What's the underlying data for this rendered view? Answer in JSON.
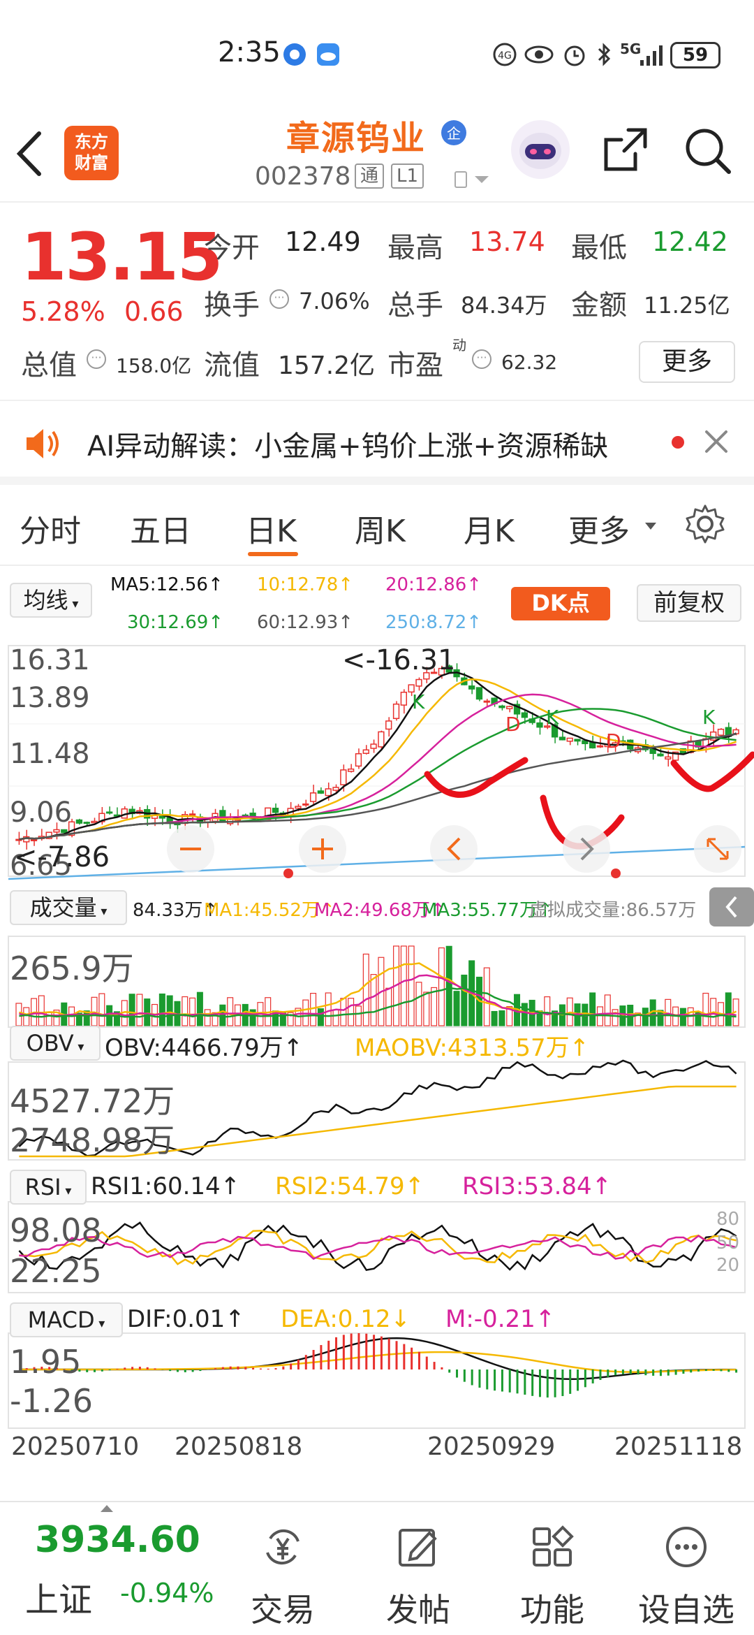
{
  "status": {
    "time": "2:35",
    "battery": "59",
    "network": "5G"
  },
  "header": {
    "name": "章源钨业",
    "code": "002378",
    "tag1": "通",
    "tag2": "L1",
    "logo_line1": "东方",
    "logo_line2": "财富"
  },
  "quote": {
    "price": "13.15",
    "pct": "5.28%",
    "chg": "0.66",
    "open_label": "今开",
    "open": "12.49",
    "high_label": "最高",
    "high": "13.74",
    "low_label": "最低",
    "low": "12.42",
    "turnover_label": "换手",
    "turnover": "7.06%",
    "volume_label": "总手",
    "volume": "84.34万",
    "amount_label": "金额",
    "amount": "11.25亿",
    "mktcap_label": "总值",
    "mktcap": "158.0亿",
    "float_label": "流值",
    "float": "157.2亿",
    "pe_label": "市盈",
    "pe_sup": "动",
    "pe": "62.32",
    "more": "更多"
  },
  "ai_bar": {
    "text": "AI异动解读：小金属+钨价上涨+资源稀缺"
  },
  "tabs": [
    "分时",
    "五日",
    "日K",
    "周K",
    "月K",
    "更多"
  ],
  "ma_panel": {
    "selector": "均线",
    "ma5": "MA5:12.56↑",
    "ma10": "10:12.78↑",
    "ma20": "20:12.86↑",
    "ma30": "30:12.69↑",
    "ma60": "60:12.93↑",
    "ma250": "250:8.72↑",
    "dk": "DK点",
    "fq": "前复权",
    "y_labels": [
      "16.31",
      "13.89",
      "11.48",
      "9.06",
      "6.65"
    ],
    "high_mark": "<-16.31",
    "low_mark": "<-7.86",
    "k_label": "K",
    "d_label": "D"
  },
  "vol_panel": {
    "selector": "成交量",
    "v": "84.33万↑",
    "ma1": "MA1:45.52万↑",
    "ma2": "MA2:49.68万↑",
    "ma3": "MA3:55.77万↑",
    "virt": "虚拟成交量:86.57万",
    "y_label": "265.9万"
  },
  "obv_panel": {
    "selector": "OBV",
    "obv": "OBV:4466.79万↑",
    "maobv": "MAOBV:4313.57万↑",
    "y1": "4527.72万",
    "y2": "2748.98万"
  },
  "rsi_panel": {
    "selector": "RSI",
    "rsi1": "RSI1:60.14↑",
    "rsi2": "RSI2:54.79↑",
    "rsi3": "RSI3:53.84↑",
    "y1": "98.08",
    "y2": "22.25",
    "r80": "80",
    "r50": "50",
    "r20": "20"
  },
  "macd_panel": {
    "selector": "MACD",
    "dif": "DIF:0.01↑",
    "dea": "DEA:0.12↓",
    "m": "M:-0.21↑",
    "y1": "1.95",
    "y2": "-1.26"
  },
  "dates": [
    "20250710",
    "20250818",
    "20250929",
    "20251118"
  ],
  "bottom_bar": {
    "index_value": "3934.60",
    "index_name": "上证",
    "index_chg": "-0.94%",
    "items": [
      "交易",
      "发帖",
      "功能",
      "设自选"
    ]
  },
  "colors": {
    "up": "#e8312e",
    "down": "#1a9b2f",
    "accent": "#f26a1b",
    "ma5": "#111111",
    "ma10": "#f5b800",
    "ma20": "#d6219c",
    "ma30": "#1a9b2f",
    "ma60": "#555555",
    "ma250": "#5fb0e6"
  }
}
